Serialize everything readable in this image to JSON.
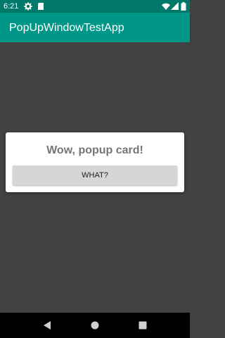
{
  "status_bar": {
    "time": "6:21",
    "icons": [
      "gear-icon",
      "sd-card-icon",
      "wifi-icon",
      "signal-icon",
      "battery-icon"
    ],
    "background": "#00796b"
  },
  "app_bar": {
    "title": "PopUpWindowTestApp",
    "background": "#009688"
  },
  "popup": {
    "message": "Wow, popup card!",
    "button_label": "WHAT?"
  },
  "nav_bar": {
    "buttons": [
      "back-icon",
      "home-icon",
      "recents-icon"
    ]
  },
  "colors": {
    "content_background": "#424242",
    "card_background": "#ffffff",
    "button_background": "#d6d6d6"
  }
}
